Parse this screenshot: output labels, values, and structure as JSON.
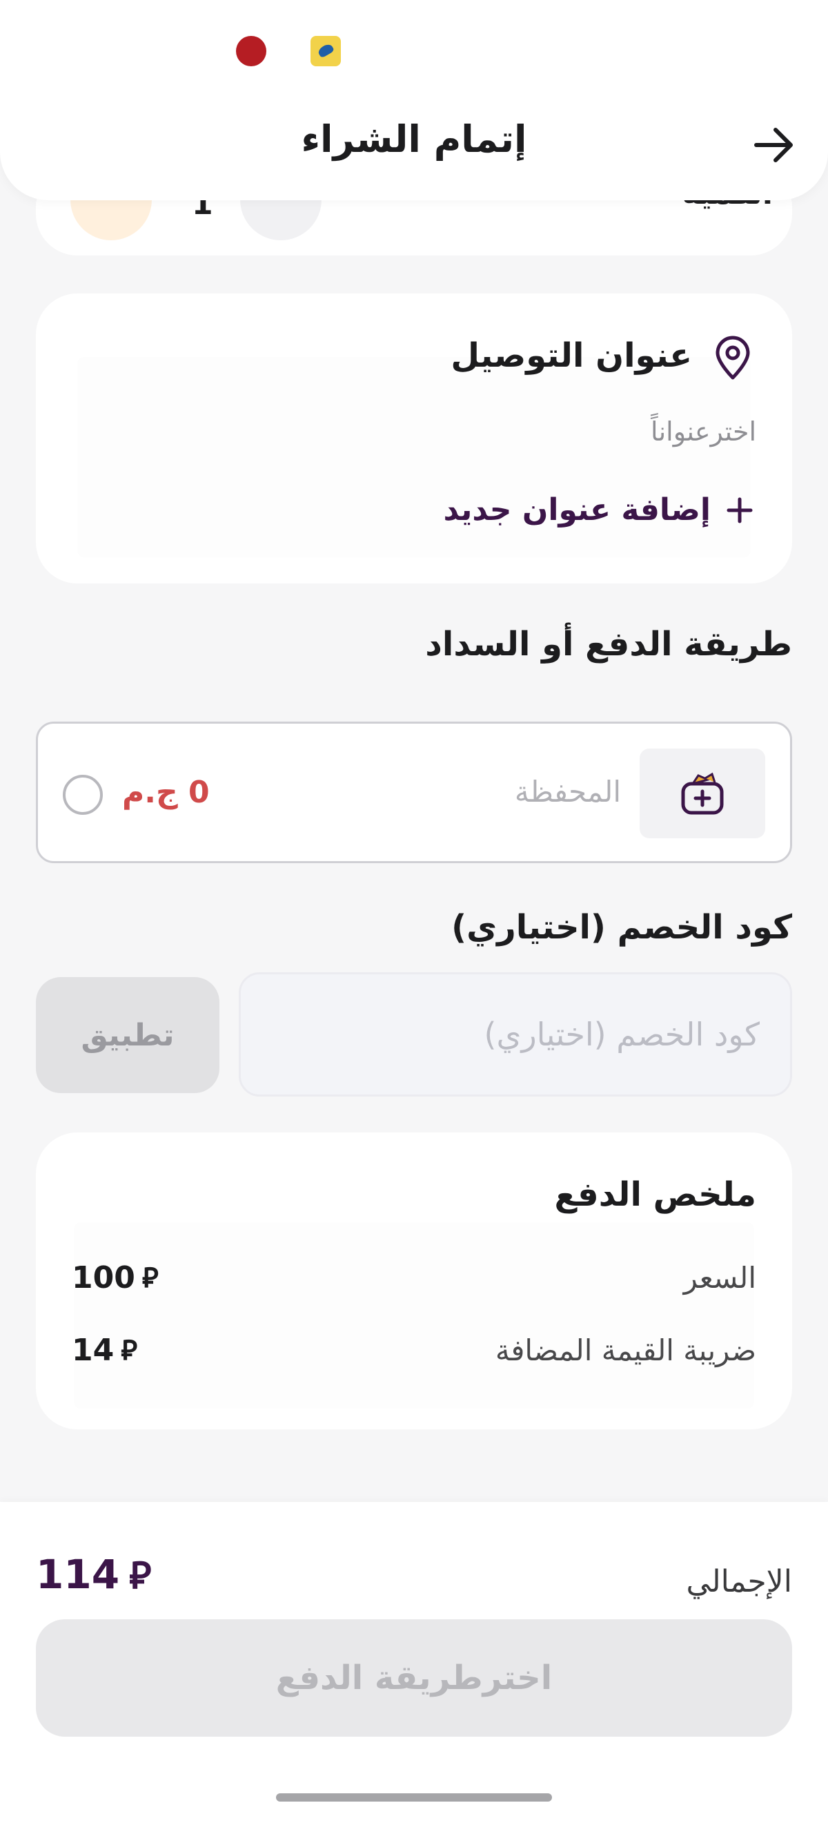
{
  "header": {
    "title": "إتمام الشراء"
  },
  "quantity": {
    "label": "الكمية",
    "value": "1"
  },
  "address": {
    "title": "عنوان التوصيل",
    "placeholder": "اخترعنواناً",
    "add_label": "إضافة عنوان جديد"
  },
  "payment": {
    "title": "طريقة الدفع أو السداد",
    "wallet_label": "المحفظة",
    "wallet_balance": "0 ج.م"
  },
  "promo": {
    "title": "كود الخصم (اختياري)",
    "placeholder": "كود الخصم (اختياري)",
    "apply_label": "تطبيق"
  },
  "summary": {
    "title": "ملخص الدفع",
    "rows": [
      {
        "label": "السعر",
        "value": "100"
      },
      {
        "label": "ضريبة القيمة المضافة",
        "value": "14"
      }
    ]
  },
  "total": {
    "label": "الإجمالي",
    "value": "114"
  },
  "currency_symbol": "⃁",
  "pay_button_label": "اخترطريقة الدفع",
  "colors": {
    "accent": "#3b1548",
    "balance": "#d04a4a"
  }
}
